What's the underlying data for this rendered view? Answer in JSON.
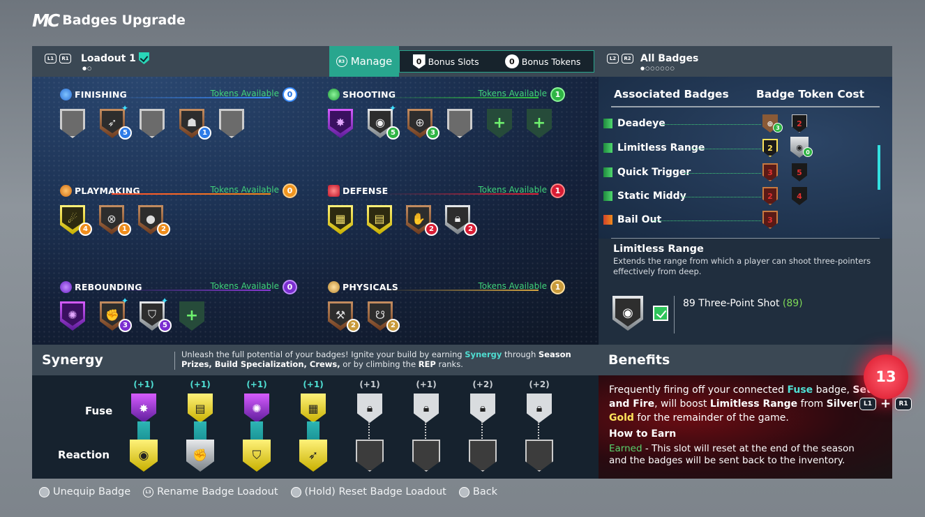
{
  "header": {
    "logo": "MC",
    "title": "Badges Upgrade"
  },
  "loadout": {
    "btn_l1": "L1",
    "btn_r1": "R1",
    "name": "Loadout 1",
    "page_dots": "●○"
  },
  "manage": {
    "icon": "R3",
    "label": "Manage"
  },
  "bonus": {
    "slots_value": "0",
    "slots_label": "Bonus Slots",
    "tokens_value": "0",
    "tokens_label": "Bonus Tokens"
  },
  "categories": [
    {
      "name": "FINISHING",
      "tokens_label": "Tokens Available",
      "tokens": "0",
      "color": "#3a8dff"
    },
    {
      "name": "SHOOTING",
      "tokens_label": "Tokens Available",
      "tokens": "1",
      "color": "#31c744"
    },
    {
      "name": "PLAYMAKING",
      "tokens_label": "Tokens Available",
      "tokens": "0",
      "color": "#f08a1c"
    },
    {
      "name": "DEFENSE",
      "tokens_label": "Tokens Available",
      "tokens": "1",
      "color": "#e0243a"
    },
    {
      "name": "REBOUNDING",
      "tokens_label": "Tokens Available",
      "tokens": "0",
      "color": "#8a3ad6"
    },
    {
      "name": "PHYSICALS",
      "tokens_label": "Tokens Available",
      "tokens": "1",
      "color": "#d5a642"
    }
  ],
  "badge_levels": {
    "fin_2": "5",
    "fin_4": "1",
    "sho_2": "5",
    "sho_3": "3",
    "pla_1": "4",
    "pla_2": "1",
    "pla_3": "2",
    "def_3": "2",
    "def_4": "2",
    "reb_2": "3",
    "reb_3": "5",
    "phy_1": "2",
    "phy_2": "2"
  },
  "right": {
    "btn_l2": "L2",
    "btn_r2": "R2",
    "title": "All Badges",
    "page_dots": "●○○○○○○",
    "col_associated": "Associated Badges",
    "col_cost": "Badge Token Cost",
    "associated": [
      {
        "name": "Deadeye",
        "cost": "2",
        "level": "3"
      },
      {
        "name": "Limitless Range",
        "cost": "2",
        "level": "0"
      },
      {
        "name": "Quick Trigger",
        "cost": "3",
        "cost2": "5"
      },
      {
        "name": "Static Middy",
        "cost": "2",
        "cost2": "4"
      },
      {
        "name": "Bail Out",
        "cost": "3"
      }
    ],
    "detail_title": "Limitless Range",
    "detail_desc": "Extends the range from which a player can shoot three-pointers effectively from deep.",
    "req_text": "89 Three-Point Shot",
    "req_value": "(89)"
  },
  "synergy": {
    "title": "Synergy",
    "desc_1": "Unleash the full potential of your badges! Ignite your build by earning ",
    "desc_hl": "Synergy",
    "desc_2": " through ",
    "desc_b1": "Season Prizes, Build Specialization, Crews,",
    "desc_3": " or by climbing the ",
    "desc_b2": "REP",
    "desc_4": " ranks.",
    "fuse_label": "Fuse",
    "reaction_label": "Reaction",
    "bonuses": [
      "(+1)",
      "(+1)",
      "(+1)",
      "(+1)",
      "(+1)",
      "(+1)",
      "(+2)",
      "(+2)"
    ]
  },
  "benefits": {
    "title": "Benefits",
    "t1": "Frequently firing off your connected ",
    "fuse": "Fuse",
    "t2": " badge, ",
    "b1": "Set and Fire",
    "t3": ", will boost ",
    "b2": "Limitless Range",
    "t4": " from ",
    "b3": "Silver",
    "t5": " to ",
    "gold": "Gold",
    "t6": " for the remainder of the game.",
    "how_title": "How to Earn",
    "earned": "Earned",
    "how_text": " - This slot will reset at the end of the season and the badges will be sent back to the inventory."
  },
  "rep": {
    "value": "13",
    "plus": "+",
    "btn_l1": "L1",
    "btn_r1": "R1"
  },
  "footer": {
    "unequip": "Unequip Badge",
    "rename_icon": "L3",
    "rename": "Rename Badge Loadout",
    "reset": "(Hold) Reset Badge Loadout",
    "back": "Back"
  }
}
